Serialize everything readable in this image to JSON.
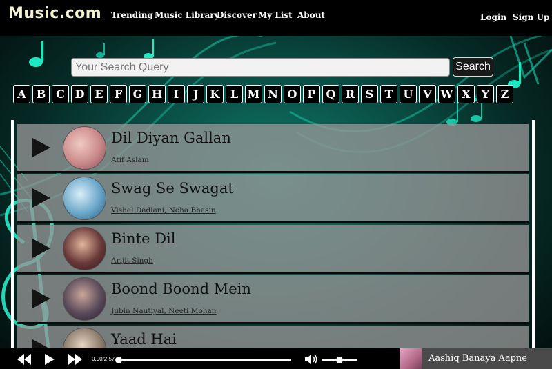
{
  "header": {
    "logo": "Music.com",
    "nav": [
      "Trending",
      "Music Library",
      "Discover",
      "My List",
      "About"
    ],
    "login": "Login",
    "signup": "Sign Up"
  },
  "search": {
    "placeholder": "Your Search Query",
    "value": "",
    "button": "Search"
  },
  "alphabet": [
    "A",
    "B",
    "C",
    "D",
    "E",
    "F",
    "G",
    "H",
    "I",
    "J",
    "K",
    "L",
    "M",
    "N",
    "O",
    "P",
    "Q",
    "R",
    "S",
    "T",
    "U",
    "V",
    "W",
    "X",
    "Y",
    "Z"
  ],
  "songs": [
    {
      "title": "Dil Diyan Gallan",
      "artist": "Atif Aslam",
      "thumb_color": "#c98a8a"
    },
    {
      "title": "Swag Se Swagat",
      "artist": "Vishal Dadlani, Neha Bhasin",
      "thumb_color": "#6aa6c9"
    },
    {
      "title": "Binte Dil",
      "artist": "Arijit Singh",
      "thumb_color": "#6a3a3a"
    },
    {
      "title": "Boond Boond Mein",
      "artist": "Jubin Nautiyal, Neeti Mohan",
      "thumb_color": "#5a4a5a"
    },
    {
      "title": "Yaad Hai",
      "artist": "",
      "thumb_color": "#8a7a6a"
    }
  ],
  "player": {
    "time": "0.00/2.57",
    "progress": 0,
    "volume": 0.5,
    "now_playing": "Aashiq Banaya Aapne"
  },
  "colors": {
    "accent": "#1de9c3",
    "background_teal": "#0f7a6a"
  }
}
